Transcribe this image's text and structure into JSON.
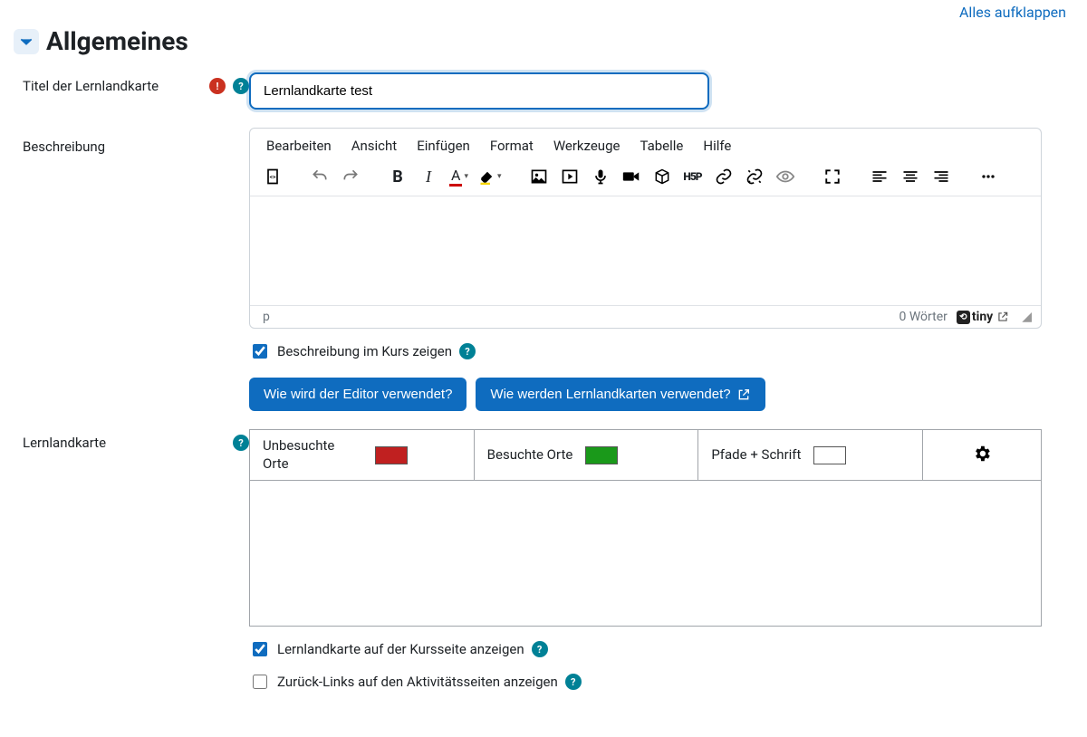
{
  "header": {
    "expand_all": "Alles aufklappen",
    "section_title": "Allgemeines"
  },
  "fields": {
    "title_label": "Titel der Lernlandkarte",
    "title_value": "Lernlandkarte test",
    "description_label": "Beschreibung",
    "map_label": "Lernlandkarte"
  },
  "editor": {
    "menu": {
      "edit": "Bearbeiten",
      "view": "Ansicht",
      "insert": "Einfügen",
      "format": "Format",
      "tools": "Werkzeuge",
      "table": "Tabelle",
      "help": "Hilfe"
    },
    "status_path": "p",
    "word_count": "0 Wörter",
    "brand": "tiny"
  },
  "checkboxes": {
    "show_description_label": "Beschreibung im Kurs zeigen",
    "show_description_checked": true,
    "show_on_course_label": "Lernlandkarte auf der Kursseite anzeigen",
    "show_on_course_checked": true,
    "backlinks_label": "Zurück-Links auf den Aktivitätsseiten anzeigen",
    "backlinks_checked": false
  },
  "buttons": {
    "editor_howto": "Wie wird der Editor verwendet?",
    "maps_howto": "Wie werden Lernlandkarten verwendet?"
  },
  "map_panel": {
    "unvisited_label": "Unbesuchte Orte",
    "visited_label": "Besuchte Orte",
    "paths_label": "Pfade + Schrift",
    "colors": {
      "unvisited": "#c02020",
      "visited": "#1a991a",
      "paths": "#ffffff"
    }
  }
}
